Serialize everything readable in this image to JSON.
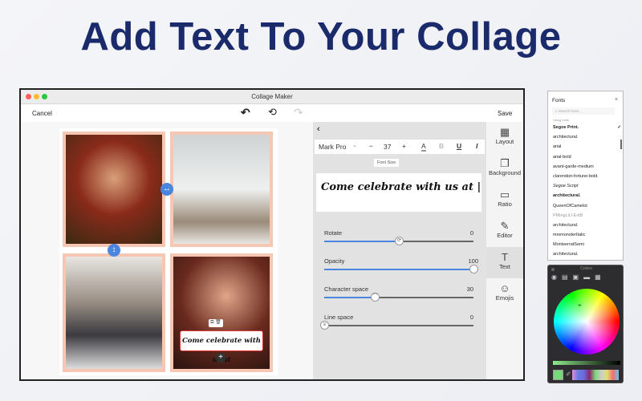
{
  "headline": "Add Text To Your Collage",
  "window": {
    "title": "Collage Maker",
    "cancel": "Cancel",
    "save": "Save"
  },
  "text_toolbar": {
    "font": "Mark Pro",
    "size": "37",
    "minus": "−",
    "plus": "+",
    "color_btn": "A",
    "bold": "B",
    "underline": "U",
    "italic": "I",
    "tooltip": "Font Size",
    "text_value": "Come celebrate with us at "
  },
  "sliders": [
    {
      "label": "Rotate",
      "value": "0",
      "fraction": 0.5,
      "knob": "⟳"
    },
    {
      "label": "Opacity",
      "value": "100",
      "fraction": 1.0,
      "knob": ""
    },
    {
      "label": "Character space",
      "value": "30",
      "fraction": 0.34,
      "knob": "⌒"
    },
    {
      "label": "Line space",
      "value": "0",
      "fraction": 0.0,
      "knob": "≡"
    }
  ],
  "tabs": [
    {
      "label": "Layout",
      "icon": "▦"
    },
    {
      "label": "Background",
      "icon": "❐"
    },
    {
      "label": "Ratio",
      "icon": "▭"
    },
    {
      "label": "Editor",
      "icon": "✎"
    },
    {
      "label": "Text",
      "icon": "T"
    },
    {
      "label": "Emojis",
      "icon": "☺"
    }
  ],
  "collage_caption": "Come celebrate with us at",
  "fonts_panel": {
    "title": "Fonts",
    "search_placeholder": "Search fonts...",
    "section": "Using fonts",
    "items": [
      "Segoe Print.",
      "architectural.",
      "arial",
      "arial-bold",
      "avant-garde-medium",
      "clarendon-fortune-bold.",
      "Segoe Script",
      "architectural.",
      "QueenOfCamelot",
      "PMingLiU-ExtB",
      "architectural.",
      "mrsmonsterItalic",
      "MontserratSemi",
      "architectural."
    ],
    "selected_index": 0
  },
  "colors_panel": {
    "title": "Colors",
    "current_color": "#7ed67a"
  },
  "accent": "#4a86e0"
}
